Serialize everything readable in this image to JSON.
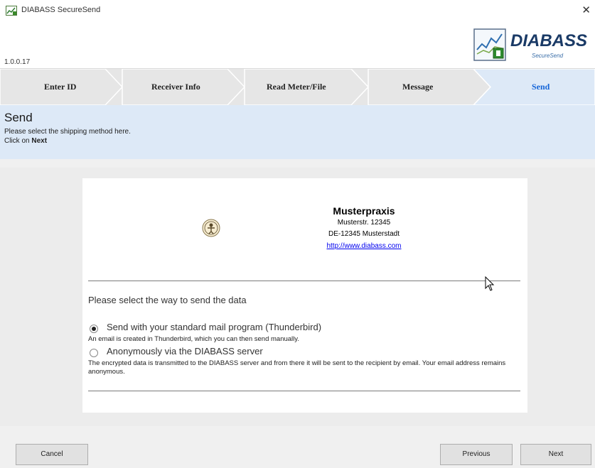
{
  "window": {
    "title": "DIABASS SecureSend",
    "close_glyph": "✕",
    "version": "1.0.0.17"
  },
  "logo": {
    "name": "DIABASS",
    "subtitle": "SecureSend"
  },
  "wizard": {
    "steps": [
      {
        "label": "Enter ID",
        "active": false
      },
      {
        "label": "Receiver Info",
        "active": false
      },
      {
        "label": "Read Meter/File",
        "active": false
      },
      {
        "label": "Message",
        "active": false
      },
      {
        "label": "Send",
        "active": true
      }
    ]
  },
  "section": {
    "title": "Send",
    "line1": "Please select the shipping method here.",
    "line2_prefix": "Click on ",
    "line2_bold": "Next"
  },
  "practice": {
    "name": "Musterpraxis",
    "street": "Musterstr. 12345",
    "city": "DE-12345 Musterstadt",
    "url": "http://www.diabass.com"
  },
  "shipping": {
    "prompt": "Please select the way to send the data",
    "options": [
      {
        "label": "Send with your standard mail program (Thunderbird)",
        "description": "An email is created in Thunderbird, which you can then send manually.",
        "selected": true
      },
      {
        "label": "Anonymously via the DIABASS server",
        "description": "The encrypted data is transmitted to the DIABASS server and from there it will be sent to the recipient by email. Your email address remains anonymous.",
        "selected": false
      }
    ]
  },
  "buttons": {
    "cancel": "Cancel",
    "previous": "Previous",
    "next": "Next"
  },
  "colors": {
    "active_step": "#1565d8",
    "section_bg": "#dde9f7"
  }
}
